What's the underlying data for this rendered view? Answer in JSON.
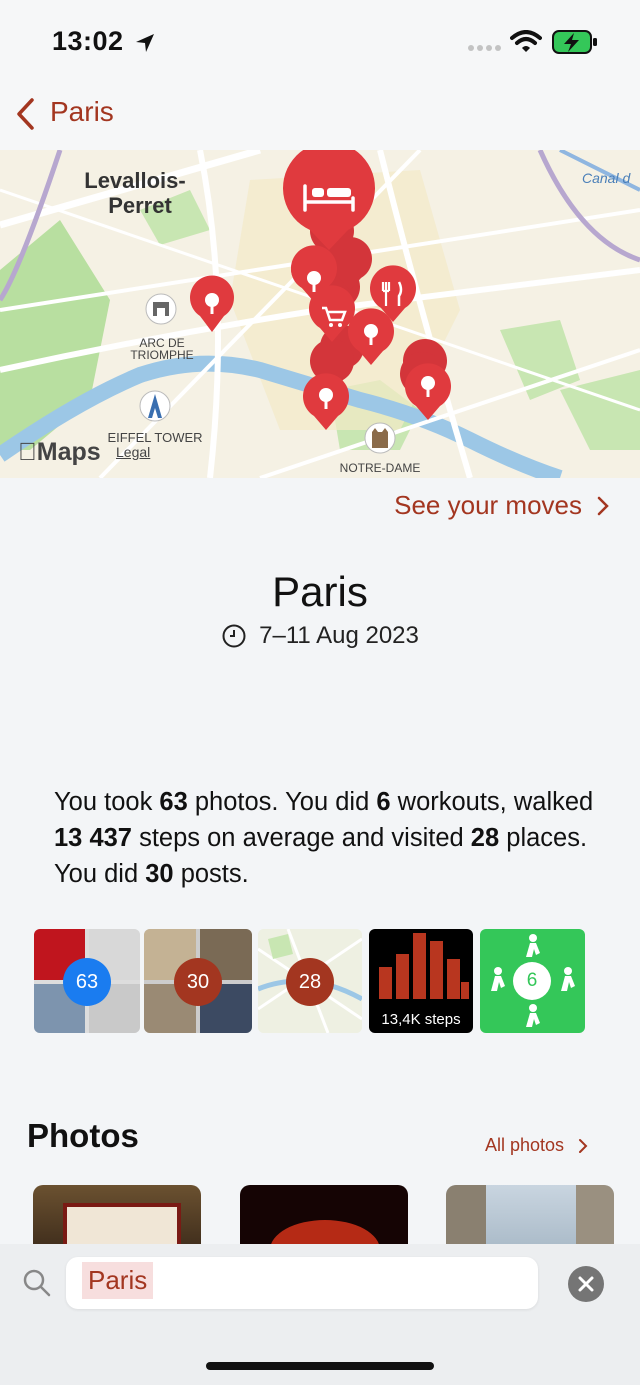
{
  "status_bar": {
    "time": "13:02"
  },
  "nav": {
    "back_label": "Paris"
  },
  "map": {
    "labels": {
      "levallois": "Levallois-\nPerret",
      "arc": "ARC DE\nTRIOMPHE",
      "eiffel": "EIFFEL TOWER",
      "notre_dame": "NOTRE-DAME",
      "canal": "Canal d"
    },
    "brand": "Maps",
    "legal": "Legal"
  },
  "see_moves_label": "See your moves",
  "trip": {
    "title": "Paris",
    "dates": "7–11 Aug 2023"
  },
  "summary": {
    "t1": "You took ",
    "photos": "63",
    "t2": " photos. You did ",
    "workouts": "6",
    "t3": " workouts, walked ",
    "steps": "13 437",
    "t4": " steps on average and visited ",
    "places": "28",
    "t5": " places. You did ",
    "posts": "30",
    "t6": " posts."
  },
  "tiles": {
    "photos_count": "63",
    "posts_count": "30",
    "places_count": "28",
    "steps_label": "13,4K steps",
    "workouts_count": "6"
  },
  "photos_section": {
    "heading": "Photos",
    "all_label": "All photos"
  },
  "search": {
    "value": "Paris"
  },
  "colors": {
    "accent": "#a33620",
    "pin": "#e03a3e",
    "badge_blue": "#1a7cf0",
    "badge_rust": "#a33620",
    "workout_green": "#34c759"
  }
}
